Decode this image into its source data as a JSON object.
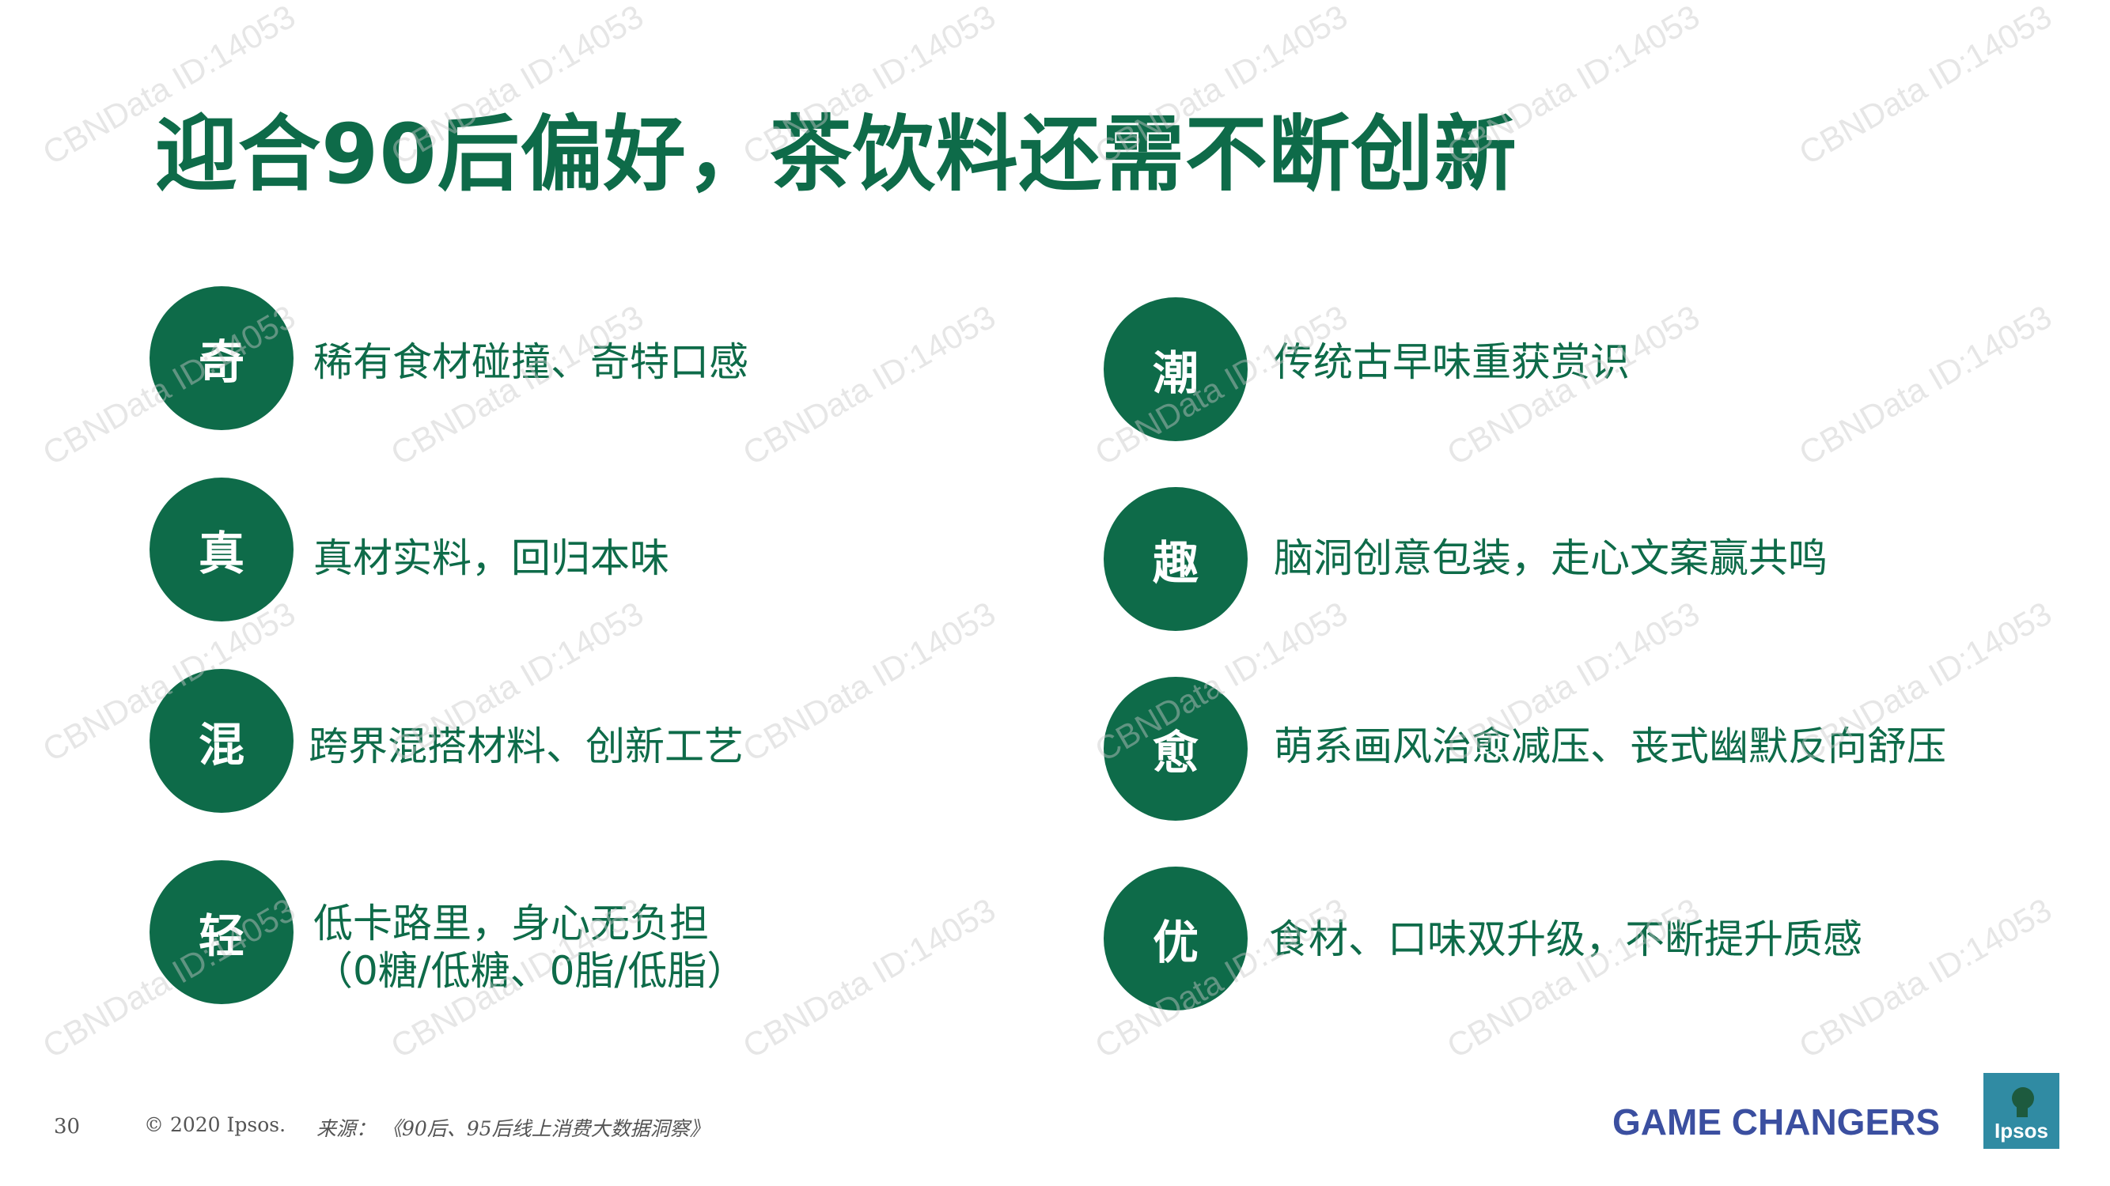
{
  "title": "迎合90后偏好，茶饮料还需不断创新",
  "colors": {
    "brand_green": "#0e6b49",
    "tagline_blue": "#3b4fa0",
    "logo_teal": "#29a3a3"
  },
  "items_left": [
    {
      "badge": "奇",
      "lines": [
        "稀有食材碰撞、奇特口感"
      ]
    },
    {
      "badge": "真",
      "lines": [
        "真材实料，回归本味"
      ]
    },
    {
      "badge": "混",
      "lines": [
        "跨界混搭材料、创新工艺"
      ]
    },
    {
      "badge": "轻",
      "lines": [
        "低卡路里，身心无负担",
        "（0糖/低糖、0脂/低脂）"
      ]
    }
  ],
  "items_right": [
    {
      "badge": "潮",
      "lines": [
        "传统古早味重获赏识"
      ]
    },
    {
      "badge": "趣",
      "lines": [
        "脑洞创意包装，走心文案赢共鸣"
      ]
    },
    {
      "badge": "愈",
      "lines": [
        "萌系画风治愈减压、丧式幽默反向舒压"
      ]
    },
    {
      "badge": "优",
      "lines": [
        "食材、口味双升级，不断提升质感"
      ]
    }
  ],
  "footer": {
    "page_number": "30",
    "copyright": "© 2020 Ipsos.",
    "source": "来源：  《90后、95后线上消费大数据洞察》"
  },
  "tagline": "GAME CHANGERS",
  "logo": {
    "text": "Ipsos",
    "icon": "ipsos-logo"
  },
  "watermark": "CBNData ID:14053"
}
